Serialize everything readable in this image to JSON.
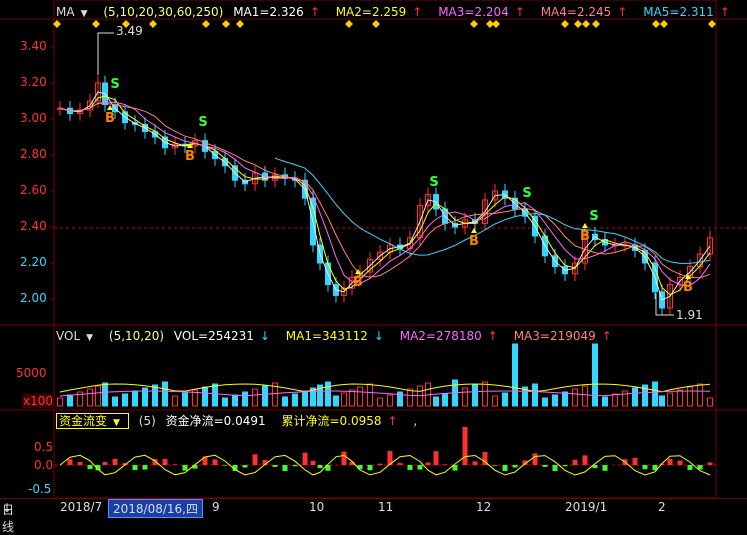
{
  "main_header": {
    "indicator_label": "MA",
    "params": "(5,10,20,30,60,250)",
    "ma1": "MA1=2.326",
    "ma2": "MA2=2.259",
    "ma3": "MA3=2.204",
    "ma4": "MA4=2.245",
    "ma5": "MA5=2.311",
    "arrow_up": "↑",
    "arrow_down": "↓"
  },
  "vol_header": {
    "indicator_label": "VOL",
    "params": "(5,10,20)",
    "vol": "VOL=254231",
    "ma1": "MA1=343112",
    "ma2": "MA2=278180",
    "ma3": "MA3=219049"
  },
  "flow_header": {
    "indicator_label": "资金流变",
    "params": "(5)",
    "net": "资金净流=0.0491",
    "cum": "累计净流=0.0958",
    "tail": ","
  },
  "price_axis": [
    "3.40",
    "3.20",
    "3.00",
    "2.80",
    "2.60",
    "2.40",
    "2.20",
    "2.00"
  ],
  "vol_axis": [
    "5000",
    "x100"
  ],
  "flow_axis": [
    "0.5",
    "0.0",
    "-0.5"
  ],
  "annotations": {
    "high": "3.49",
    "low": "1.91"
  },
  "signals": {
    "buy": "B",
    "sell": "S"
  },
  "bottom_bar": {
    "period": "日线",
    "period_arrow": "↓",
    "date_labels": [
      "2018/7",
      "9",
      "10",
      "11",
      "12",
      "2019/1",
      "2"
    ],
    "cursor_date": "2018/08/16,四"
  },
  "colors": {
    "up": "#ff3030",
    "down": "#33d6ff",
    "ma5": "#e8e8e8",
    "ma10": "#ffff00",
    "ma20": "#ff66ff",
    "ma30": "#ff8080",
    "ma60": "#33d6ff",
    "grid": "#7a0000"
  },
  "chart_data": {
    "type": "candlestick",
    "price_range": [
      1.91,
      3.49
    ],
    "x_labels": [
      "2018/7",
      "9",
      "10",
      "11",
      "12",
      "2019/1",
      "2"
    ]
  }
}
